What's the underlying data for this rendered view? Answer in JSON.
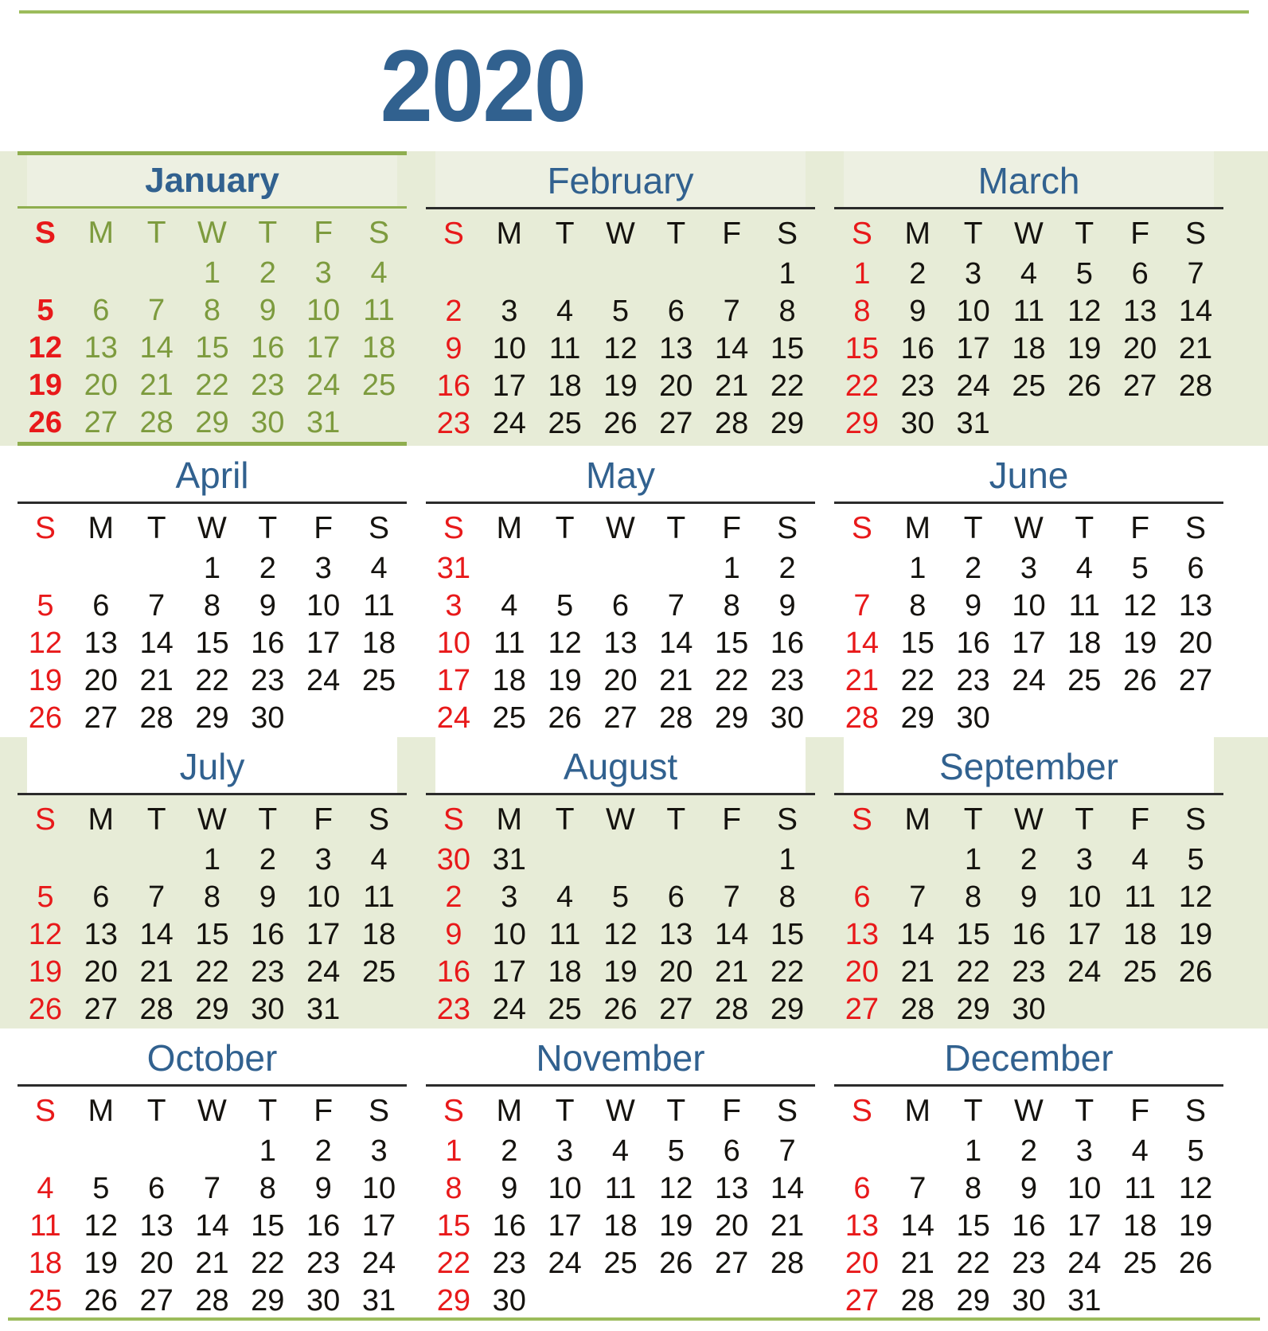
{
  "year_title": "2020",
  "accent_colors": {
    "rule_green": "#9cbc5b",
    "band_green": "#e7ecd7",
    "title_blue": "#31618f",
    "sunday_red": "#e8191a",
    "january_olive": "#7d9b3e"
  },
  "weekday_headers": [
    "S",
    "M",
    "T",
    "W",
    "T",
    "F",
    "S"
  ],
  "chart_data": {
    "type": "table",
    "title": "2020",
    "note": "Twelve-month year calendar grid, weeks start on Sunday"
  },
  "months": [
    {
      "name": "January",
      "weeks": [
        [
          "",
          "",
          "",
          "1",
          "2",
          "3",
          "4"
        ],
        [
          "5",
          "6",
          "7",
          "8",
          "9",
          "10",
          "11"
        ],
        [
          "12",
          "13",
          "14",
          "15",
          "16",
          "17",
          "18"
        ],
        [
          "19",
          "20",
          "21",
          "22",
          "23",
          "24",
          "25"
        ],
        [
          "26",
          "27",
          "28",
          "29",
          "30",
          "31",
          ""
        ]
      ]
    },
    {
      "name": "February",
      "weeks": [
        [
          "",
          "",
          "",
          "",
          "",
          "",
          "1"
        ],
        [
          "2",
          "3",
          "4",
          "5",
          "6",
          "7",
          "8"
        ],
        [
          "9",
          "10",
          "11",
          "12",
          "13",
          "14",
          "15"
        ],
        [
          "16",
          "17",
          "18",
          "19",
          "20",
          "21",
          "22"
        ],
        [
          "23",
          "24",
          "25",
          "26",
          "27",
          "28",
          "29"
        ]
      ]
    },
    {
      "name": "March",
      "weeks": [
        [
          "1",
          "2",
          "3",
          "4",
          "5",
          "6",
          "7"
        ],
        [
          "8",
          "9",
          "10",
          "11",
          "12",
          "13",
          "14"
        ],
        [
          "15",
          "16",
          "17",
          "18",
          "19",
          "20",
          "21"
        ],
        [
          "22",
          "23",
          "24",
          "25",
          "26",
          "27",
          "28"
        ],
        [
          "29",
          "30",
          "31",
          "",
          "",
          "",
          ""
        ]
      ]
    },
    {
      "name": "April",
      "weeks": [
        [
          "",
          "",
          "",
          "1",
          "2",
          "3",
          "4"
        ],
        [
          "5",
          "6",
          "7",
          "8",
          "9",
          "10",
          "11"
        ],
        [
          "12",
          "13",
          "14",
          "15",
          "16",
          "17",
          "18"
        ],
        [
          "19",
          "20",
          "21",
          "22",
          "23",
          "24",
          "25"
        ],
        [
          "26",
          "27",
          "28",
          "29",
          "30",
          "",
          ""
        ]
      ]
    },
    {
      "name": "May",
      "weeks": [
        [
          "31",
          "",
          "",
          "",
          "",
          "1",
          "2"
        ],
        [
          "3",
          "4",
          "5",
          "6",
          "7",
          "8",
          "9"
        ],
        [
          "10",
          "11",
          "12",
          "13",
          "14",
          "15",
          "16"
        ],
        [
          "17",
          "18",
          "19",
          "20",
          "21",
          "22",
          "23"
        ],
        [
          "24",
          "25",
          "26",
          "27",
          "28",
          "29",
          "30"
        ]
      ]
    },
    {
      "name": "June",
      "weeks": [
        [
          "",
          "1",
          "2",
          "3",
          "4",
          "5",
          "6"
        ],
        [
          "7",
          "8",
          "9",
          "10",
          "11",
          "12",
          "13"
        ],
        [
          "14",
          "15",
          "16",
          "17",
          "18",
          "19",
          "20"
        ],
        [
          "21",
          "22",
          "23",
          "24",
          "25",
          "26",
          "27"
        ],
        [
          "28",
          "29",
          "30",
          "",
          "",
          "",
          ""
        ]
      ]
    },
    {
      "name": "July",
      "weeks": [
        [
          "",
          "",
          "",
          "1",
          "2",
          "3",
          "4"
        ],
        [
          "5",
          "6",
          "7",
          "8",
          "9",
          "10",
          "11"
        ],
        [
          "12",
          "13",
          "14",
          "15",
          "16",
          "17",
          "18"
        ],
        [
          "19",
          "20",
          "21",
          "22",
          "23",
          "24",
          "25"
        ],
        [
          "26",
          "27",
          "28",
          "29",
          "30",
          "31",
          ""
        ]
      ]
    },
    {
      "name": "August",
      "weeks": [
        [
          "30",
          "31",
          "",
          "",
          "",
          "",
          "1"
        ],
        [
          "2",
          "3",
          "4",
          "5",
          "6",
          "7",
          "8"
        ],
        [
          "9",
          "10",
          "11",
          "12",
          "13",
          "14",
          "15"
        ],
        [
          "16",
          "17",
          "18",
          "19",
          "20",
          "21",
          "22"
        ],
        [
          "23",
          "24",
          "25",
          "26",
          "27",
          "28",
          "29"
        ]
      ]
    },
    {
      "name": "September",
      "weeks": [
        [
          "",
          "",
          "1",
          "2",
          "3",
          "4",
          "5"
        ],
        [
          "6",
          "7",
          "8",
          "9",
          "10",
          "11",
          "12"
        ],
        [
          "13",
          "14",
          "15",
          "16",
          "17",
          "18",
          "19"
        ],
        [
          "20",
          "21",
          "22",
          "23",
          "24",
          "25",
          "26"
        ],
        [
          "27",
          "28",
          "29",
          "30",
          "",
          "",
          ""
        ]
      ]
    },
    {
      "name": "October",
      "weeks": [
        [
          "",
          "",
          "",
          "",
          "1",
          "2",
          "3"
        ],
        [
          "4",
          "5",
          "6",
          "7",
          "8",
          "9",
          "10"
        ],
        [
          "11",
          "12",
          "13",
          "14",
          "15",
          "16",
          "17"
        ],
        [
          "18",
          "19",
          "20",
          "21",
          "22",
          "23",
          "24"
        ],
        [
          "25",
          "26",
          "27",
          "28",
          "29",
          "30",
          "31"
        ]
      ]
    },
    {
      "name": "November",
      "weeks": [
        [
          "1",
          "2",
          "3",
          "4",
          "5",
          "6",
          "7"
        ],
        [
          "8",
          "9",
          "10",
          "11",
          "12",
          "13",
          "14"
        ],
        [
          "15",
          "16",
          "17",
          "18",
          "19",
          "20",
          "21"
        ],
        [
          "22",
          "23",
          "24",
          "25",
          "26",
          "27",
          "28"
        ],
        [
          "29",
          "30",
          "",
          "",
          "",
          "",
          ""
        ]
      ]
    },
    {
      "name": "December",
      "weeks": [
        [
          "",
          "",
          "1",
          "2",
          "3",
          "4",
          "5"
        ],
        [
          "6",
          "7",
          "8",
          "9",
          "10",
          "11",
          "12"
        ],
        [
          "13",
          "14",
          "15",
          "16",
          "17",
          "18",
          "19"
        ],
        [
          "20",
          "21",
          "22",
          "23",
          "24",
          "25",
          "26"
        ],
        [
          "27",
          "28",
          "29",
          "30",
          "31",
          "",
          ""
        ]
      ]
    }
  ]
}
